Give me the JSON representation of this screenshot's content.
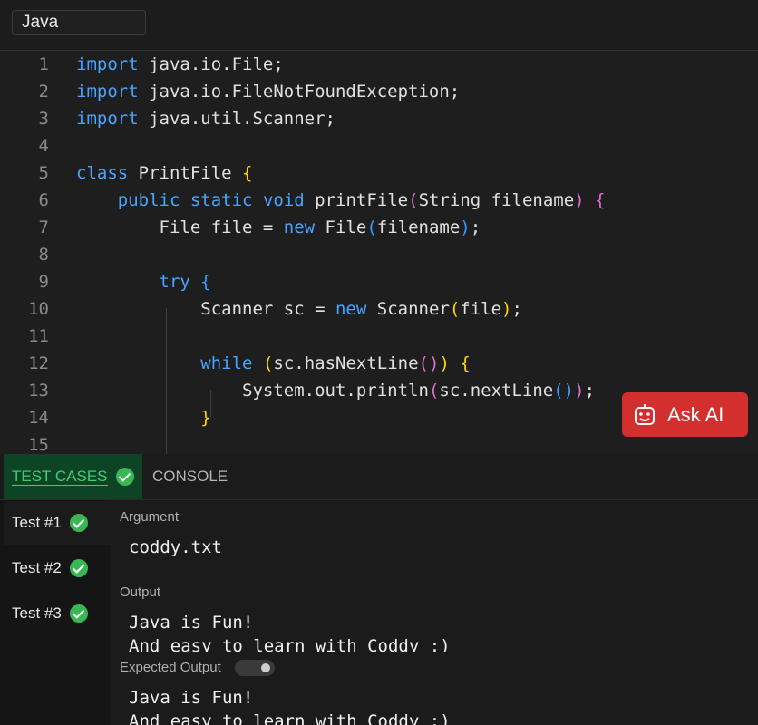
{
  "language_select": {
    "value": "Java"
  },
  "editor": {
    "line_numbers": [
      "1",
      "2",
      "3",
      "4",
      "5",
      "6",
      "7",
      "8",
      "9",
      "10",
      "11",
      "12",
      "13",
      "14",
      "15"
    ],
    "lines": [
      [
        {
          "t": "import",
          "c": "kw"
        },
        {
          "t": " java.io.File;"
        }
      ],
      [
        {
          "t": "import",
          "c": "kw"
        },
        {
          "t": " java.io.FileNotFoundException;"
        }
      ],
      [
        {
          "t": "import",
          "c": "kw"
        },
        {
          "t": " java.util.Scanner;"
        }
      ],
      [],
      [
        {
          "t": "class",
          "c": "kw"
        },
        {
          "t": " PrintFile "
        },
        {
          "t": "{",
          "c": "b1"
        }
      ],
      [
        {
          "t": "    "
        },
        {
          "t": "public",
          "c": "kw"
        },
        {
          "t": " "
        },
        {
          "t": "static",
          "c": "kw"
        },
        {
          "t": " "
        },
        {
          "t": "void",
          "c": "kw"
        },
        {
          "t": " printFile"
        },
        {
          "t": "(",
          "c": "b2"
        },
        {
          "t": "String filename"
        },
        {
          "t": ")",
          "c": "b2"
        },
        {
          "t": " "
        },
        {
          "t": "{",
          "c": "b2"
        }
      ],
      [
        {
          "t": "        File file = "
        },
        {
          "t": "new",
          "c": "kw"
        },
        {
          "t": " File"
        },
        {
          "t": "(",
          "c": "b3"
        },
        {
          "t": "filename"
        },
        {
          "t": ")",
          "c": "b3"
        },
        {
          "t": ";"
        }
      ],
      [],
      [
        {
          "t": "        "
        },
        {
          "t": "try",
          "c": "kw"
        },
        {
          "t": " "
        },
        {
          "t": "{",
          "c": "b3"
        }
      ],
      [
        {
          "t": "            Scanner sc = "
        },
        {
          "t": "new",
          "c": "kw"
        },
        {
          "t": " Scanner"
        },
        {
          "t": "(",
          "c": "b1"
        },
        {
          "t": "file"
        },
        {
          "t": ")",
          "c": "b1"
        },
        {
          "t": ";"
        }
      ],
      [],
      [
        {
          "t": "            "
        },
        {
          "t": "while",
          "c": "kw"
        },
        {
          "t": " "
        },
        {
          "t": "(",
          "c": "b1"
        },
        {
          "t": "sc.hasNextLine"
        },
        {
          "t": "()",
          "c": "b2"
        },
        {
          "t": ")",
          "c": "b1"
        },
        {
          "t": " "
        },
        {
          "t": "{",
          "c": "b1"
        }
      ],
      [
        {
          "t": "                System.out.println"
        },
        {
          "t": "(",
          "c": "b2"
        },
        {
          "t": "sc.nextLine"
        },
        {
          "t": "()",
          "c": "b3"
        },
        {
          "t": ")",
          "c": "b2"
        },
        {
          "t": ";"
        }
      ],
      [
        {
          "t": "            "
        },
        {
          "t": "}",
          "c": "b1"
        }
      ],
      []
    ]
  },
  "ask_ai": {
    "label": "Ask AI"
  },
  "tabs": {
    "test_cases": "TEST CASES",
    "console": "CONSOLE"
  },
  "tests": [
    {
      "label": "Test #1",
      "status": "passed"
    },
    {
      "label": "Test #2",
      "status": "passed"
    },
    {
      "label": "Test #3",
      "status": "passed"
    }
  ],
  "result": {
    "argument_label": "Argument",
    "argument_value": "coddy.txt",
    "output_label": "Output",
    "output_value": "Java is Fun!\nAnd easy to learn with Coddy :)",
    "expected_label": "Expected Output",
    "expected_value": "Java is Fun!\nAnd easy to learn with Coddy :)"
  },
  "colors": {
    "accent_green": "#39b754",
    "ask_ai_red": "#d32f2f",
    "keyword_blue": "#4aa3ff"
  }
}
